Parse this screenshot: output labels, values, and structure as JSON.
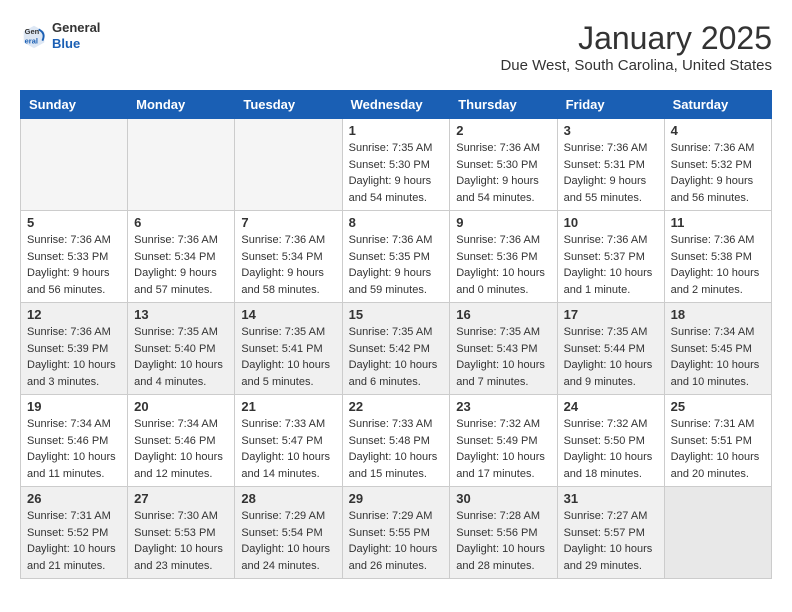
{
  "header": {
    "logo_general": "General",
    "logo_blue": "Blue",
    "title": "January 2025",
    "subtitle": "Due West, South Carolina, United States"
  },
  "calendar": {
    "days_of_week": [
      "Sunday",
      "Monday",
      "Tuesday",
      "Wednesday",
      "Thursday",
      "Friday",
      "Saturday"
    ],
    "weeks": [
      {
        "shaded": false,
        "days": [
          {
            "number": "",
            "info": ""
          },
          {
            "number": "",
            "info": ""
          },
          {
            "number": "",
            "info": ""
          },
          {
            "number": "1",
            "info": "Sunrise: 7:35 AM\nSunset: 5:30 PM\nDaylight: 9 hours\nand 54 minutes."
          },
          {
            "number": "2",
            "info": "Sunrise: 7:36 AM\nSunset: 5:30 PM\nDaylight: 9 hours\nand 54 minutes."
          },
          {
            "number": "3",
            "info": "Sunrise: 7:36 AM\nSunset: 5:31 PM\nDaylight: 9 hours\nand 55 minutes."
          },
          {
            "number": "4",
            "info": "Sunrise: 7:36 AM\nSunset: 5:32 PM\nDaylight: 9 hours\nand 56 minutes."
          }
        ]
      },
      {
        "shaded": false,
        "days": [
          {
            "number": "5",
            "info": "Sunrise: 7:36 AM\nSunset: 5:33 PM\nDaylight: 9 hours\nand 56 minutes."
          },
          {
            "number": "6",
            "info": "Sunrise: 7:36 AM\nSunset: 5:34 PM\nDaylight: 9 hours\nand 57 minutes."
          },
          {
            "number": "7",
            "info": "Sunrise: 7:36 AM\nSunset: 5:34 PM\nDaylight: 9 hours\nand 58 minutes."
          },
          {
            "number": "8",
            "info": "Sunrise: 7:36 AM\nSunset: 5:35 PM\nDaylight: 9 hours\nand 59 minutes."
          },
          {
            "number": "9",
            "info": "Sunrise: 7:36 AM\nSunset: 5:36 PM\nDaylight: 10 hours\nand 0 minutes."
          },
          {
            "number": "10",
            "info": "Sunrise: 7:36 AM\nSunset: 5:37 PM\nDaylight: 10 hours\nand 1 minute."
          },
          {
            "number": "11",
            "info": "Sunrise: 7:36 AM\nSunset: 5:38 PM\nDaylight: 10 hours\nand 2 minutes."
          }
        ]
      },
      {
        "shaded": true,
        "days": [
          {
            "number": "12",
            "info": "Sunrise: 7:36 AM\nSunset: 5:39 PM\nDaylight: 10 hours\nand 3 minutes."
          },
          {
            "number": "13",
            "info": "Sunrise: 7:35 AM\nSunset: 5:40 PM\nDaylight: 10 hours\nand 4 minutes."
          },
          {
            "number": "14",
            "info": "Sunrise: 7:35 AM\nSunset: 5:41 PM\nDaylight: 10 hours\nand 5 minutes."
          },
          {
            "number": "15",
            "info": "Sunrise: 7:35 AM\nSunset: 5:42 PM\nDaylight: 10 hours\nand 6 minutes."
          },
          {
            "number": "16",
            "info": "Sunrise: 7:35 AM\nSunset: 5:43 PM\nDaylight: 10 hours\nand 7 minutes."
          },
          {
            "number": "17",
            "info": "Sunrise: 7:35 AM\nSunset: 5:44 PM\nDaylight: 10 hours\nand 9 minutes."
          },
          {
            "number": "18",
            "info": "Sunrise: 7:34 AM\nSunset: 5:45 PM\nDaylight: 10 hours\nand 10 minutes."
          }
        ]
      },
      {
        "shaded": false,
        "days": [
          {
            "number": "19",
            "info": "Sunrise: 7:34 AM\nSunset: 5:46 PM\nDaylight: 10 hours\nand 11 minutes."
          },
          {
            "number": "20",
            "info": "Sunrise: 7:34 AM\nSunset: 5:46 PM\nDaylight: 10 hours\nand 12 minutes."
          },
          {
            "number": "21",
            "info": "Sunrise: 7:33 AM\nSunset: 5:47 PM\nDaylight: 10 hours\nand 14 minutes."
          },
          {
            "number": "22",
            "info": "Sunrise: 7:33 AM\nSunset: 5:48 PM\nDaylight: 10 hours\nand 15 minutes."
          },
          {
            "number": "23",
            "info": "Sunrise: 7:32 AM\nSunset: 5:49 PM\nDaylight: 10 hours\nand 17 minutes."
          },
          {
            "number": "24",
            "info": "Sunrise: 7:32 AM\nSunset: 5:50 PM\nDaylight: 10 hours\nand 18 minutes."
          },
          {
            "number": "25",
            "info": "Sunrise: 7:31 AM\nSunset: 5:51 PM\nDaylight: 10 hours\nand 20 minutes."
          }
        ]
      },
      {
        "shaded": true,
        "days": [
          {
            "number": "26",
            "info": "Sunrise: 7:31 AM\nSunset: 5:52 PM\nDaylight: 10 hours\nand 21 minutes."
          },
          {
            "number": "27",
            "info": "Sunrise: 7:30 AM\nSunset: 5:53 PM\nDaylight: 10 hours\nand 23 minutes."
          },
          {
            "number": "28",
            "info": "Sunrise: 7:29 AM\nSunset: 5:54 PM\nDaylight: 10 hours\nand 24 minutes."
          },
          {
            "number": "29",
            "info": "Sunrise: 7:29 AM\nSunset: 5:55 PM\nDaylight: 10 hours\nand 26 minutes."
          },
          {
            "number": "30",
            "info": "Sunrise: 7:28 AM\nSunset: 5:56 PM\nDaylight: 10 hours\nand 28 minutes."
          },
          {
            "number": "31",
            "info": "Sunrise: 7:27 AM\nSunset: 5:57 PM\nDaylight: 10 hours\nand 29 minutes."
          },
          {
            "number": "",
            "info": ""
          }
        ]
      }
    ]
  }
}
